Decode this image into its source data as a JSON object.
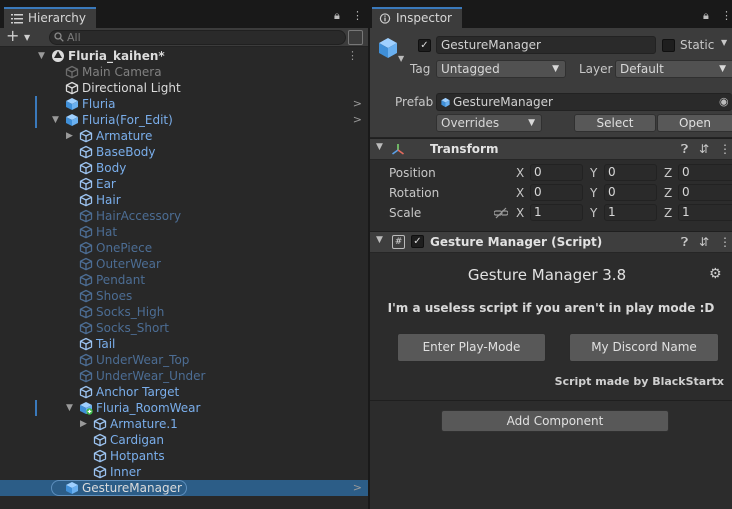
{
  "hierarchy": {
    "tab_label": "Hierarchy",
    "search_placeholder": "All",
    "scene_name": "Fluria_kaihen*",
    "rows": [
      {
        "label": "Main Camera",
        "color": "grey",
        "depth": 1,
        "arrow": "",
        "right": ""
      },
      {
        "label": "Directional Light",
        "color": "white",
        "depth": 1,
        "arrow": "",
        "right": ""
      },
      {
        "label": "Fluria",
        "color": "blue",
        "depth": 1,
        "arrow": "",
        "right": ">",
        "prefab": true,
        "mark": true
      },
      {
        "label": "Fluria(For_Edit)",
        "color": "blue",
        "depth": 1,
        "arrow": "down",
        "right": ">",
        "prefab": true,
        "mark": true
      },
      {
        "label": "Armature",
        "color": "blue",
        "depth": 2,
        "arrow": "right",
        "right": ""
      },
      {
        "label": "BaseBody",
        "color": "blue",
        "depth": 2,
        "arrow": "",
        "right": ""
      },
      {
        "label": "Body",
        "color": "blue",
        "depth": 2,
        "arrow": "",
        "right": ""
      },
      {
        "label": "Ear",
        "color": "blue",
        "depth": 2,
        "arrow": "",
        "right": ""
      },
      {
        "label": "Hair",
        "color": "blue",
        "depth": 2,
        "arrow": "",
        "right": ""
      },
      {
        "label": "HairAccessory",
        "color": "dim",
        "depth": 2,
        "arrow": "",
        "right": ""
      },
      {
        "label": "Hat",
        "color": "dim",
        "depth": 2,
        "arrow": "",
        "right": ""
      },
      {
        "label": "OnePiece",
        "color": "dim",
        "depth": 2,
        "arrow": "",
        "right": ""
      },
      {
        "label": "OuterWear",
        "color": "dim",
        "depth": 2,
        "arrow": "",
        "right": ""
      },
      {
        "label": "Pendant",
        "color": "dim",
        "depth": 2,
        "arrow": "",
        "right": ""
      },
      {
        "label": "Shoes",
        "color": "dim",
        "depth": 2,
        "arrow": "",
        "right": ""
      },
      {
        "label": "Socks_High",
        "color": "dim",
        "depth": 2,
        "arrow": "",
        "right": ""
      },
      {
        "label": "Socks_Short",
        "color": "dim",
        "depth": 2,
        "arrow": "",
        "right": ""
      },
      {
        "label": "Tail",
        "color": "blue",
        "depth": 2,
        "arrow": "",
        "right": ""
      },
      {
        "label": "UnderWear_Top",
        "color": "dim",
        "depth": 2,
        "arrow": "",
        "right": ""
      },
      {
        "label": "UnderWear_Under",
        "color": "dim",
        "depth": 2,
        "arrow": "",
        "right": ""
      },
      {
        "label": "Anchor Target",
        "color": "blue",
        "depth": 2,
        "arrow": "",
        "right": ""
      },
      {
        "label": "Fluria_RoomWear",
        "color": "blue",
        "depth": 2,
        "arrow": "down",
        "right": "",
        "prefab": true,
        "added": true,
        "mark": true
      },
      {
        "label": "Armature.1",
        "color": "blue",
        "depth": 3,
        "arrow": "right",
        "right": ""
      },
      {
        "label": "Cardigan",
        "color": "blue",
        "depth": 3,
        "arrow": "",
        "right": ""
      },
      {
        "label": "Hotpants",
        "color": "blue",
        "depth": 3,
        "arrow": "",
        "right": ""
      },
      {
        "label": "Inner",
        "color": "blue",
        "depth": 3,
        "arrow": "",
        "right": ""
      },
      {
        "label": "GestureManager",
        "color": "white",
        "depth": 1,
        "arrow": "",
        "right": ">",
        "prefab": true,
        "selected": true
      }
    ]
  },
  "inspector": {
    "tab_label": "Inspector",
    "object_name": "GestureManager",
    "static_label": "Static",
    "tag_label": "Tag",
    "tag_value": "Untagged",
    "layer_label": "Layer",
    "layer_value": "Default",
    "prefab_label": "Prefab",
    "prefab_value": "GestureManager",
    "overrides_label": "Overrides",
    "select_label": "Select",
    "open_label": "Open",
    "transform": {
      "title": "Transform",
      "position_label": "Position",
      "rotation_label": "Rotation",
      "scale_label": "Scale",
      "axes": [
        "X",
        "Y",
        "Z"
      ],
      "position": [
        "0",
        "0",
        "0"
      ],
      "rotation": [
        "0",
        "0",
        "0"
      ],
      "scale": [
        "1",
        "1",
        "1"
      ]
    },
    "script": {
      "title": "Gesture Manager (Script)",
      "heading": "Gesture Manager 3.8",
      "subtitle": "I'm a useless script if you aren't in play mode :D",
      "enter_play_label": "Enter Play-Mode",
      "discord_label": "My Discord Name",
      "credit": "Script made by BlackStartx"
    },
    "add_component_label": "Add Component"
  },
  "colors": {
    "selection": "#2c5d87",
    "prefab_blue": "#7aaeeb",
    "accent": "#3a79bb"
  }
}
